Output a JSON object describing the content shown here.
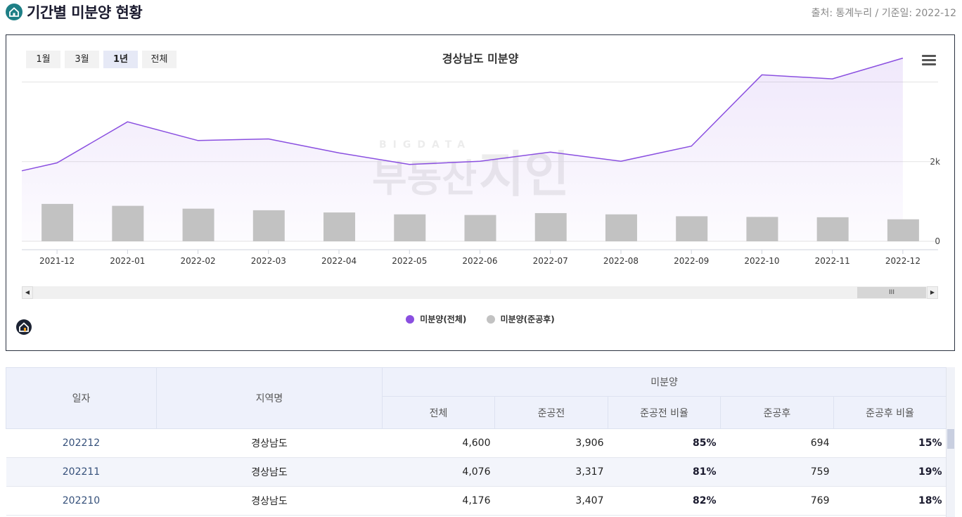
{
  "header": {
    "title": "기간별 미분양 현황",
    "source": "출처: 통계누리 / 기준일: 2022-12"
  },
  "chart_panel": {
    "range_buttons": [
      {
        "label": "1월",
        "active": false
      },
      {
        "label": "3월",
        "active": false
      },
      {
        "label": "1년",
        "active": true
      },
      {
        "label": "전체",
        "active": false
      }
    ],
    "watermark_letters": "BIGDATA",
    "watermark_text": "부동산",
    "watermark_brand": "지인",
    "scroll_thumb_label": "III",
    "scroll_left_glyph": "◀",
    "scroll_right_glyph": "▶"
  },
  "chart_data": {
    "type": "line+bar",
    "title": "경상남도 미분양",
    "categories": [
      "2021-12",
      "2022-01",
      "2022-02",
      "2022-03",
      "2022-04",
      "2022-05",
      "2022-06",
      "2022-07",
      "2022-08",
      "2022-09",
      "2022-10",
      "2022-11",
      "2022-12"
    ],
    "series": [
      {
        "name": "미분양(전체)",
        "type": "area-line",
        "color": "#8a4fe0",
        "values": [
          1970,
          3000,
          2530,
          2570,
          2220,
          1930,
          2010,
          2240,
          2010,
          2390,
          4180,
          4080,
          4600
        ]
      },
      {
        "name": "미분양(준공후)",
        "type": "bar",
        "color": "#c2c2c2",
        "values": [
          1180,
          1120,
          1030,
          980,
          910,
          850,
          830,
          890,
          850,
          790,
          769,
          759,
          694
        ]
      }
    ],
    "y_ticks": [
      "0",
      "2k"
    ],
    "ylim": [
      0,
      5000
    ],
    "grid": true,
    "legend_position": "bottom-center"
  },
  "table": {
    "headers": {
      "date": "일자",
      "region": "지역명",
      "group": "미분양",
      "total": "전체",
      "before": "준공전",
      "before_ratio": "준공전 비율",
      "after": "준공후",
      "after_ratio": "준공후 비율"
    },
    "rows": [
      {
        "date": "202212",
        "region": "경상남도",
        "total": "4,600",
        "before": "3,906",
        "before_ratio": "85%",
        "after": "694",
        "after_ratio": "15%"
      },
      {
        "date": "202211",
        "region": "경상남도",
        "total": "4,076",
        "before": "3,317",
        "before_ratio": "81%",
        "after": "759",
        "after_ratio": "19%"
      },
      {
        "date": "202210",
        "region": "경상남도",
        "total": "4,176",
        "before": "3,407",
        "before_ratio": "82%",
        "after": "769",
        "after_ratio": "18%"
      }
    ]
  }
}
